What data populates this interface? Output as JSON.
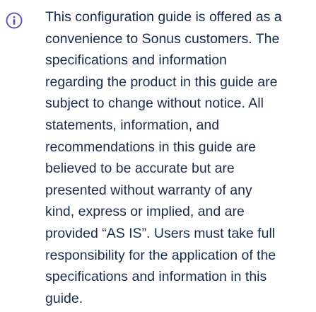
{
  "notice": {
    "icon": "info-icon",
    "icon_color": "#6554c0",
    "text_color": "#172b4d",
    "lines": [
      "This configuration guide is offered as a",
      "convenience to Sonus customers. The",
      "specifications and information",
      "regarding the product in this guide are",
      "subject to change without notice. All",
      "statements, information, and",
      "recommendations in this guide are",
      "believed to be accurate but are",
      "presented without warranty of any",
      "kind, express or implied, and are",
      "provided “AS IS”. Users must take full",
      "responsibility for the application of the",
      "specifications and information in this",
      "guide."
    ]
  }
}
